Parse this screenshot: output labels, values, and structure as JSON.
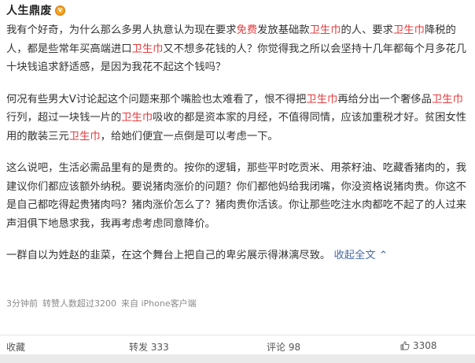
{
  "author": {
    "name": "人生鼎废",
    "badge_glyph": "v"
  },
  "paragraphs": [
    [
      {
        "text": "我有个好奇，为什么那么多男人执意认为现在要求",
        "hl": false
      },
      {
        "text": "免费",
        "hl": true
      },
      {
        "text": "发放基础款",
        "hl": false
      },
      {
        "text": "卫生巾",
        "hl": true
      },
      {
        "text": "的人、要求",
        "hl": false
      },
      {
        "text": "卫生巾",
        "hl": true
      },
      {
        "text": "降税的人，都是些常年买高端进口",
        "hl": false
      },
      {
        "text": "卫生巾",
        "hl": true
      },
      {
        "text": "又不想多花钱的人？你觉得我之所以会坚持十几年都每个月多花几十块钱追求舒适感，是因为我花不起这个钱吗？",
        "hl": false
      }
    ],
    [
      {
        "text": "何况有些男大V讨论起这个问题来那个嘴脸也太难看了，恨不得把",
        "hl": false
      },
      {
        "text": "卫生巾",
        "hl": true
      },
      {
        "text": "再给分出一个奢侈品",
        "hl": false
      },
      {
        "text": "卫生巾",
        "hl": true
      },
      {
        "text": "行列，超过一块钱一片的",
        "hl": false
      },
      {
        "text": "卫生巾",
        "hl": true
      },
      {
        "text": "吸收的都是资本家的月经，不值得同情，应该加重税才好。贫困女性用的散装三元",
        "hl": false
      },
      {
        "text": "卫生巾",
        "hl": true
      },
      {
        "text": "，给她们便宜一点倒是可以考虑一下。",
        "hl": false
      }
    ],
    [
      {
        "text": "这么说吧，生活必需品里有的是贵的。按你的逻辑，那些平时吃贡米、用茶籽油、吃藏香猪肉的，我建议你们都应该额外纳税。要说猪肉涨价的问题？你们都他妈给我闭嘴，你没资格说猪肉贵。你这不是自己都吃得起贵猪肉吗？猪肉涨价怎么了？猪肉贵你活该。你让那些吃注水肉都吃不起了的人过来声泪俱下地恳求我，我再考虑考虑同意降价。",
        "hl": false
      }
    ],
    [
      {
        "text": "一群自以为姓赵的韭菜，在这个舞台上把自己的卑劣展示得淋漓尽致。 ",
        "hl": false
      }
    ]
  ],
  "expand_label": "收起全文",
  "expand_arrow": "⌃",
  "meta": {
    "time": "3分钟前",
    "repost_info": "转赞人数超过3200",
    "source": "来自 iPhone客户端"
  },
  "actions": {
    "favorite": "收藏",
    "repost": "转发 333",
    "comment": "评论 98",
    "like": "3308"
  },
  "colors": {
    "highlight": "#e4393c",
    "link": "#496aa5"
  }
}
